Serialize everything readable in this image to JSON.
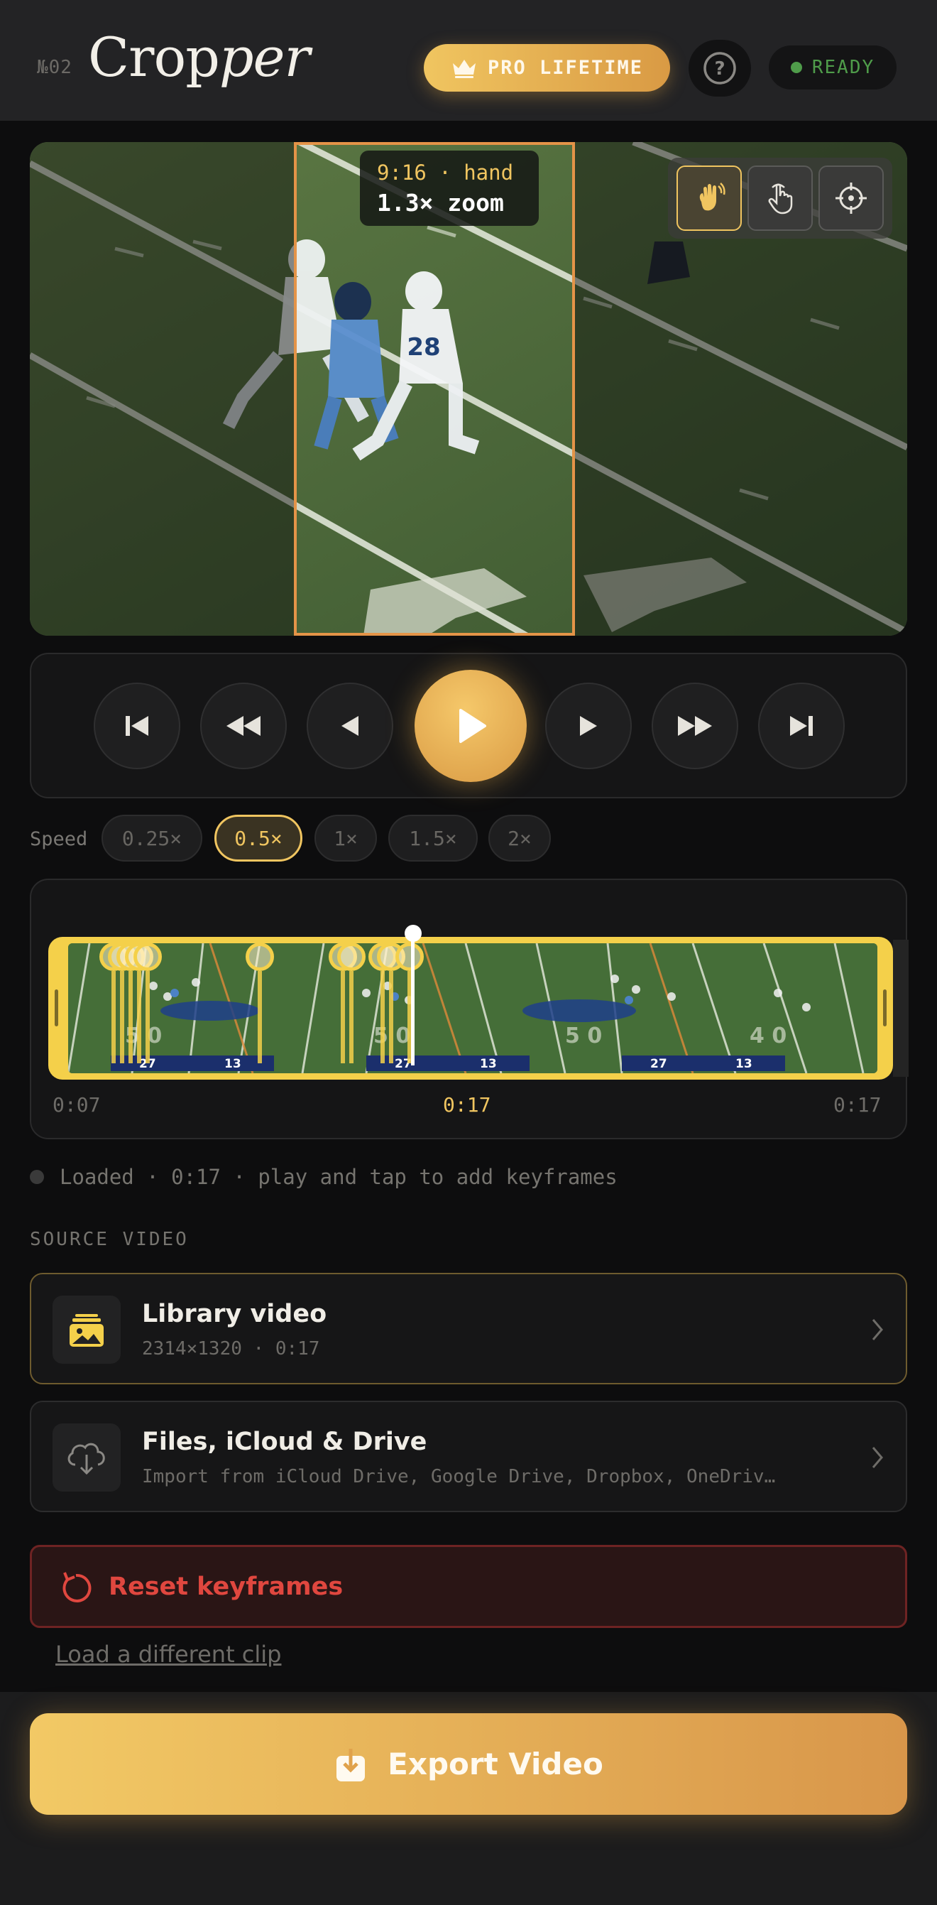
{
  "header": {
    "edition": "№02",
    "brand_prefix": "Crop",
    "brand_suffix": "per",
    "pro_label": "PRO LIFETIME",
    "help_label": "?",
    "status_label": "READY"
  },
  "preview": {
    "crop_ratio": "9:16 · hand",
    "crop_zoom": "1.3× zoom",
    "modes": [
      {
        "name": "hand-mode",
        "icon": "hand-wave-icon",
        "active": true
      },
      {
        "name": "touch-mode",
        "icon": "pointer-hand-icon",
        "active": false
      },
      {
        "name": "track-mode",
        "icon": "crosshair-icon",
        "active": false
      }
    ]
  },
  "transport": {
    "buttons": [
      "skip-to-start",
      "rewind",
      "step-back",
      "play",
      "step-forward",
      "fast-forward",
      "skip-to-end"
    ]
  },
  "speed": {
    "label": "Speed",
    "options": [
      "0.25×",
      "0.5×",
      "1×",
      "1.5×",
      "2×"
    ],
    "selected": "0.5×"
  },
  "timeline": {
    "start_time": "0:07",
    "current_time": "0:17",
    "end_time": "0:17",
    "frame_stats": [
      "5 0",
      "27",
      "13",
      "5 0",
      "27",
      "13",
      "27",
      "13",
      "5 0",
      "4 0"
    ]
  },
  "status": {
    "text": "Loaded · 0:17 · play and tap to add keyframes"
  },
  "source": {
    "heading": "SOURCE VIDEO",
    "library": {
      "title": "Library video",
      "subtitle": "2314×1320 · 0:17"
    },
    "files": {
      "title": "Files, iCloud & Drive",
      "subtitle": "Import from iCloud Drive, Google Drive, Dropbox, OneDriv…"
    }
  },
  "actions": {
    "reset_label": "Reset keyframes",
    "load_different_label": "Load a different clip",
    "export_label": "Export Video"
  },
  "colors": {
    "accent": "#f0c560",
    "accent_dark": "#d99a44",
    "danger": "#e0473f",
    "ready": "#4f9c4a",
    "crop_frame": "#e49448"
  }
}
